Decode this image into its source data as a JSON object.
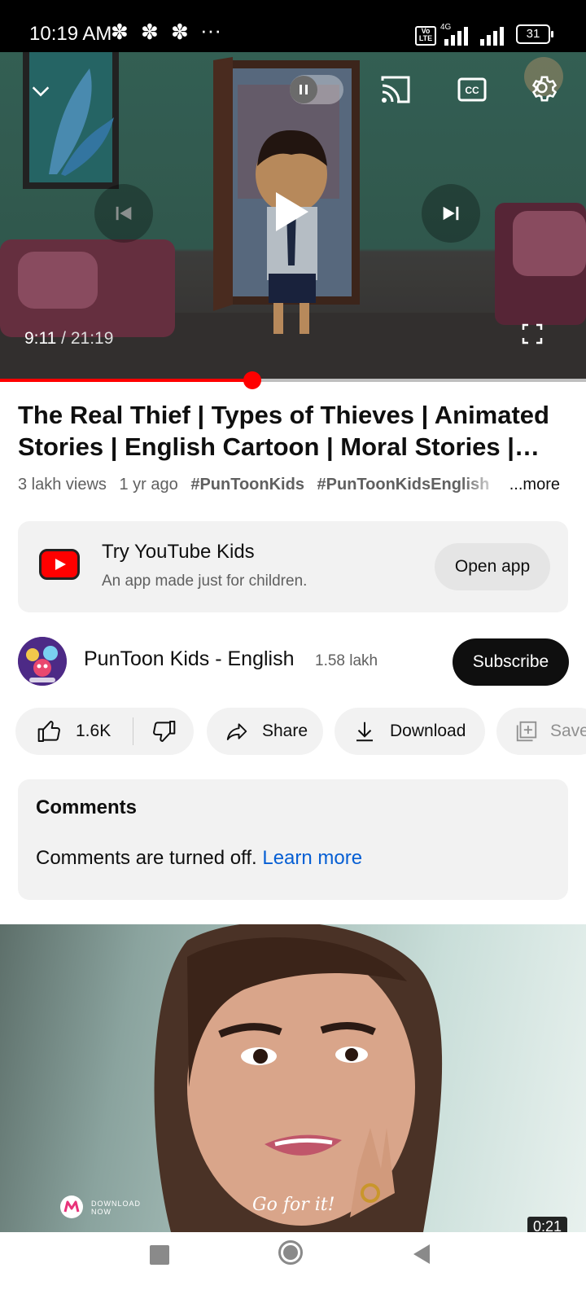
{
  "status_bar": {
    "time": "10:19 AM",
    "notification_icons": "✽ ✽ ✽",
    "more": "···",
    "volte": "Vo LTE",
    "network": "4G",
    "battery": "31"
  },
  "player": {
    "current_time": "9:11",
    "separator": " / ",
    "duration": "21:19",
    "progress": 0.43,
    "state": "paused"
  },
  "video": {
    "title": "The Real Thief | Types of Thieves | Animated Stories | English Cartoon | Moral Stories | PunToon Kids English",
    "views": "3 lakh views",
    "age": "1 yr ago",
    "tags": [
      "#PunToonKids",
      "#PunToonKidsEnglish"
    ],
    "more_label": "...more"
  },
  "promo": {
    "title": "Try YouTube Kids",
    "subtitle": "An app made just for children.",
    "button": "Open app"
  },
  "channel": {
    "name": "PunToon Kids - English",
    "subscribers": "1.58 lakh",
    "subscribe_label": "Subscribe"
  },
  "actions": {
    "likes": "1.6K",
    "share": "Share",
    "download": "Download",
    "save": "Save"
  },
  "comments": {
    "title": "Comments",
    "message": "Comments are turned off. ",
    "link": "Learn more"
  },
  "ad": {
    "duration": "0:21",
    "cta": "DOWNLOAD NOW",
    "slogan": "Go for it!"
  },
  "colors": {
    "accent_red": "#ff0000",
    "link_blue": "#065fd4",
    "subscribe_bg": "#0f0f0f"
  }
}
